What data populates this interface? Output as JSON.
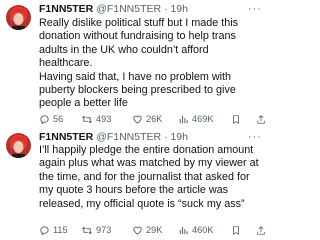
{
  "tweets": [
    {
      "name": "F1NN5TER",
      "handle": "@F1NN5TER",
      "separator": "·",
      "time": "19h",
      "more_label": "···",
      "text": [
        "Really dislike political stuff but I made this donation without fundraising to help trans adults in the UK who couldn’t afford healthcare.",
        "Having said that, I have no problem with puberty blockers being prescribed to give people a better life"
      ],
      "replies": "56",
      "retweets": "493",
      "likes": "26K",
      "views": "469K"
    },
    {
      "name": "F1NN5TER",
      "handle": "@F1NN5TER",
      "separator": "·",
      "time": "19h",
      "more_label": "···",
      "text": [
        "I’ll happily pledge the entire donation amount again plus what was matched by my viewer at the time, and for the journalist that asked for my quote 3 hours before the article was released, my official quote is “suck my ass”"
      ],
      "replies": "115",
      "retweets": "973",
      "likes": "29K",
      "views": "460K"
    }
  ],
  "icons": {
    "reply": "reply-icon",
    "retweet": "retweet-icon",
    "like": "heart-icon",
    "views": "views-chart-icon",
    "bookmark": "bookmark-icon",
    "share": "share-icon"
  },
  "colors": {
    "text": "#0f1419",
    "secondary": "#536471",
    "avatar_bg": "#c0392b"
  }
}
